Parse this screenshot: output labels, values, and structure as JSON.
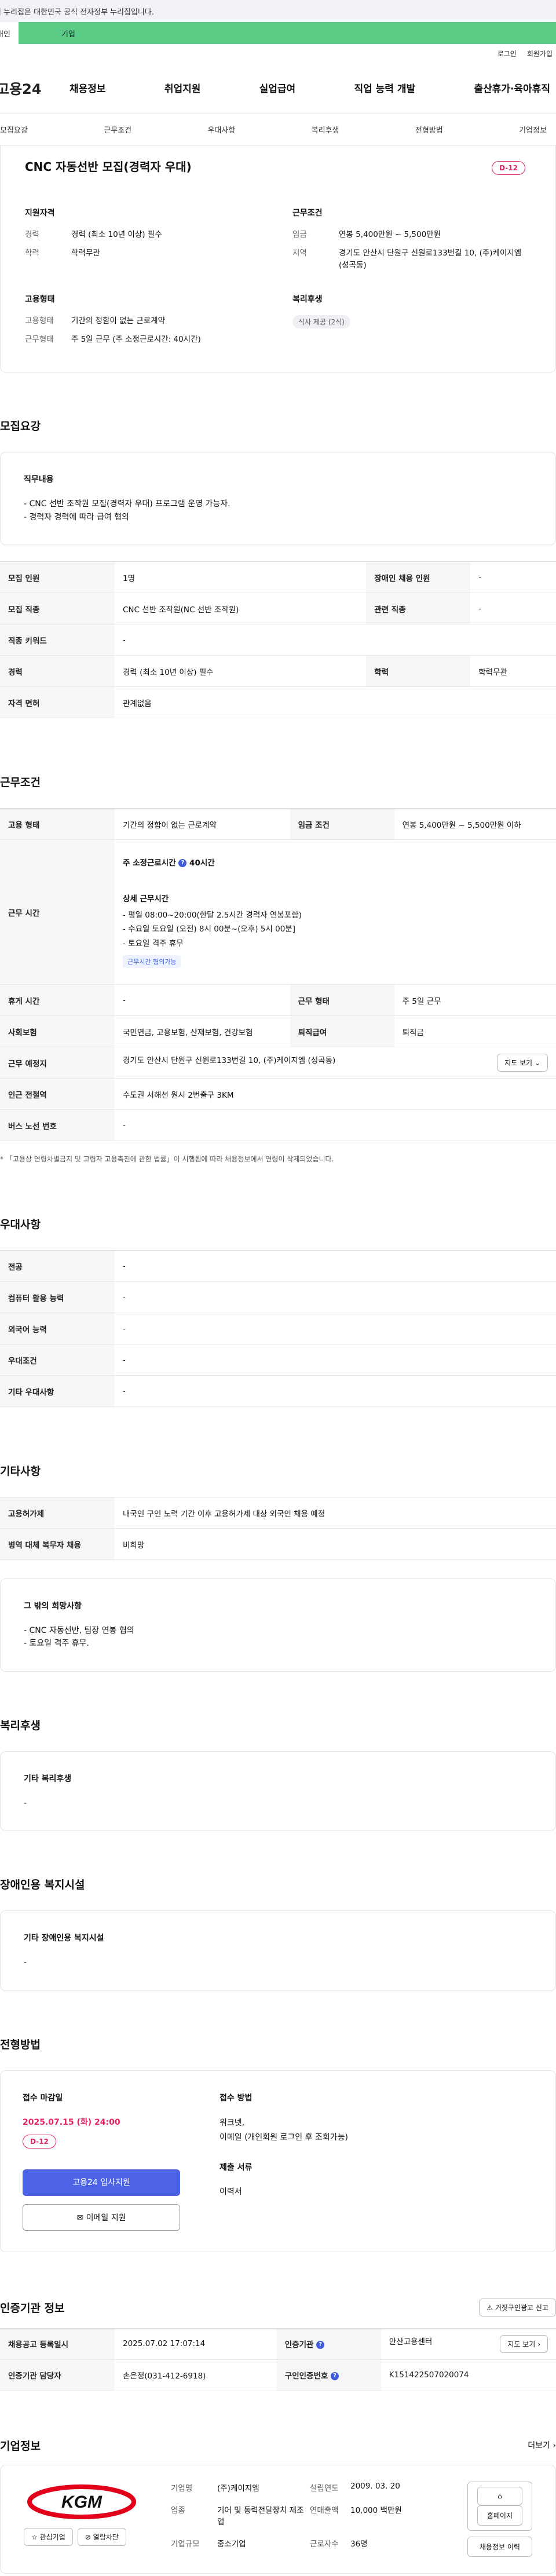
{
  "gov_bar": "이 누리집은 대한민국 공식 전자정부 누리집입니다.",
  "svc": {
    "individual": "개인",
    "business": "기업"
  },
  "util": {
    "login": "로그인",
    "signup": "회원가입"
  },
  "gnb": {
    "logo": "고용24",
    "menu": [
      "채용정보",
      "취업지원",
      "실업급여",
      "직업 능력 개발",
      "출산휴가·육아휴직"
    ]
  },
  "subtabs": [
    "모집요강",
    "근무조건",
    "우대사항",
    "복리후생",
    "전형방법",
    "기업정보"
  ],
  "summary": {
    "title": "CNC 자동선반 모집(경력자 우대)",
    "dday": "D-12",
    "qual": {
      "heading": "지원자격",
      "career_k": "경력",
      "career_v": "경력 (최소 10년 이상) 필수",
      "edu_k": "학력",
      "edu_v": "학력무관"
    },
    "work": {
      "heading": "근무조건",
      "wage_k": "임금",
      "wage_v": "연봉 5,400만원 ~ 5,500만원",
      "area_k": "지역",
      "area_v": "경기도 안산시 단원구 신원로133번길 10, (주)케이지엠(성곡동)"
    },
    "emp": {
      "heading": "고용형태",
      "type_k": "고용형태",
      "type_v": "기간의 정함이 없는 근로계약",
      "form_k": "근무형태",
      "form_v": "주 5일 근무 (주 소정근로시간: 40시간)"
    },
    "welfare": {
      "heading": "복리후생",
      "pill": "식사 제공 (2식)"
    }
  },
  "recruit": {
    "heading": "모집요강",
    "duty_title": "직무내용",
    "duty": [
      "- CNC 선반 조작원 모집(경력자 우대) 프로그램 운영 가능자.",
      "- 경력자 경력에 따라 급여 협의"
    ],
    "rows": [
      [
        "모집 인원",
        "1명",
        "장애인 채용 인원",
        "-"
      ],
      [
        "모집 직종",
        "CNC 선반 조작원(NC 선반 조작원)",
        "관련 직종",
        "-"
      ],
      [
        "직종 키워드",
        "-"
      ],
      [
        "경력",
        "경력 (최소 10년 이상) 필수",
        "학력",
        "학력무관"
      ],
      [
        "자격 면허",
        "관계없음"
      ]
    ]
  },
  "cond": {
    "heading": "근무조건",
    "emp_type_k": "고용 형태",
    "emp_type_v": "기간의 정함이 없는 근로계약",
    "wage_k": "임금 조건",
    "wage_v": "연봉 5,400만원 ~ 5,500만원 이하",
    "hours_k": "근무 시간",
    "hours_main_a": "주 소정근로시간",
    "hours_main_b": "40시간",
    "hours_detail_title": "상세 근무시간",
    "hours_lines": [
      "- 평일 08:00~20:00(한달 2.5시간 경력자 연봉포함)",
      "- 수요일 토요일 (오전) 8시 00분~(오후) 5시 00분]",
      "- 토요일 격주 휴무"
    ],
    "hours_badge": "근무시간 협의가능",
    "rest_k": "휴게 시간",
    "rest_v": "-",
    "form_k": "근무 형태",
    "form_v": "주 5일 근무",
    "ins_k": "사회보험",
    "ins_v": "국민연금, 고용보험, 산재보험, 건강보험",
    "sev_k": "퇴직급여",
    "sev_v": "퇴직금",
    "place_k": "근무 예정지",
    "place_v": "경기도 안산시 단원구 신원로133번길 10, (주)케이지엠 (성곡동)",
    "map_btn": "지도 보기",
    "sub_k": "인근 전철역",
    "sub_v": "수도권 서해선 원시 2번출구 3KM",
    "bus_k": "버스 노선 번호",
    "bus_v": "-",
    "note": "* 「고용상 연령차별금지 및 고령자 고용촉진에 관한 법률」이 시행됨에 따라 채용정보에서 연령이 삭제되었습니다."
  },
  "pref": {
    "heading": "우대사항",
    "rows": [
      [
        "전공",
        "-"
      ],
      [
        "컴퓨터 활용 능력",
        "-"
      ],
      [
        "외국어 능력",
        "-"
      ],
      [
        "우대조건",
        "-"
      ],
      [
        "기타 우대사항",
        "-"
      ]
    ]
  },
  "etc": {
    "heading": "기타사항",
    "rows": [
      [
        "고용허가제",
        "내국인 구인 노력 기간 이후 고용허가제 대상 외국인 채용 예정"
      ],
      [
        "병역 대체 복무자 채용",
        "비희망"
      ]
    ],
    "hope_title": "그 밖의 희망사항",
    "hope": [
      "- CNC 자동선반, 팀장 연봉 협의",
      "- 토요일 격주 휴무."
    ]
  },
  "welfare": {
    "heading": "복리후생",
    "title": "기타 복리후생",
    "value": "-"
  },
  "disab": {
    "heading": "장애인용 복지시설",
    "title": "기타 장애인용 복지시설",
    "value": "-"
  },
  "select": {
    "heading": "전형방법",
    "deadline_title": "접수 마감일",
    "deadline": "2025.07.15 (화) 24:00",
    "dday": "D-12",
    "apply_btn": "고용24 입사지원",
    "email_btn": "이메일 지원",
    "method_title": "접수 방법",
    "methods": [
      "워크넷,",
      "이메일 (개인회원 로그인 후 조회가능)"
    ],
    "docs_title": "제출 서류",
    "docs": "이력서"
  },
  "cert": {
    "heading": "인증기관 정보",
    "report_btn": "거짓구인광고 신고",
    "reg_k": "채용공고 등록일시",
    "reg_v": "2025.07.02 17:07:14",
    "org_k": "인증기관",
    "org_v": "안산고용센터",
    "map_btn": "지도 보기",
    "mgr_k": "인증기관 담당자",
    "mgr_v": "손은정(031-412-6918)",
    "num_k": "구인인증번호",
    "num_v": "K151422507020074"
  },
  "company": {
    "heading": "기업정보",
    "more": "더보기",
    "logo_text": "KGM",
    "fav_btn": "관심기업",
    "block_btn": "열람차단",
    "name_k": "기업명",
    "name_v": "(주)케이지엠",
    "found_k": "설립연도",
    "found_v": "2009. 03. 20",
    "biz_k": "업종",
    "biz_v": "기어 및 동력전달장치 제조업",
    "sales_k": "연매출액",
    "sales_v": "10,000 백만원",
    "scale_k": "기업규모",
    "scale_v": "중소기업",
    "emp_k": "근로자수",
    "emp_v": "36명",
    "home_btn": "홈페이지",
    "jobs_btn": "채용정보 이력"
  }
}
